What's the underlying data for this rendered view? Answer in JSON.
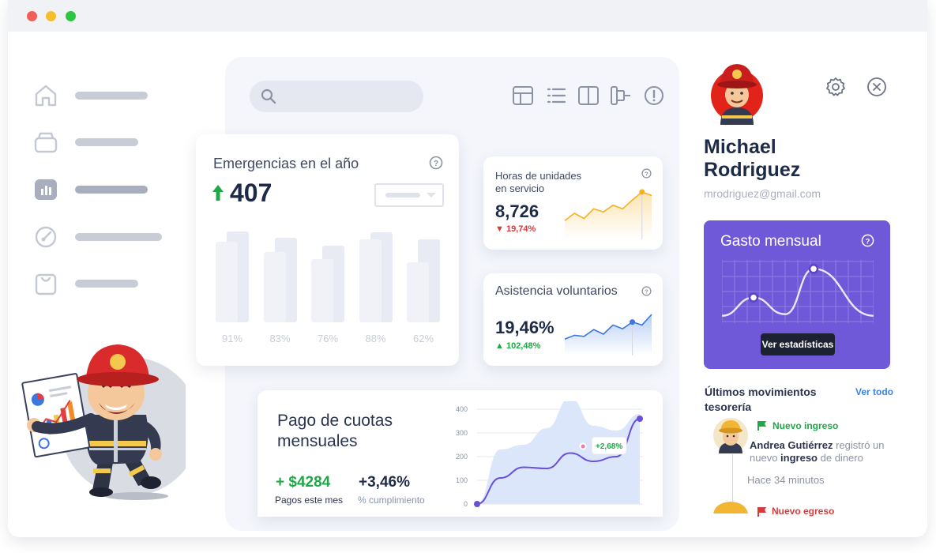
{
  "emergencias": {
    "title": "Emergencias en el año",
    "value": "407",
    "bars": [
      {
        "label": "91%",
        "back": 0.92,
        "front": 0.82
      },
      {
        "label": "83%",
        "back": 0.86,
        "front": 0.71
      },
      {
        "label": "76%",
        "back": 0.78,
        "front": 0.64
      },
      {
        "label": "88%",
        "back": 0.91,
        "front": 0.84
      },
      {
        "label": "62%",
        "back": 0.84,
        "front": 0.61
      }
    ]
  },
  "horas": {
    "title_line1": "Horas de unidades",
    "title_line2": "en servicio",
    "value": "8,726",
    "delta": "19,74%",
    "trend": [
      0.35,
      0.52,
      0.4,
      0.62,
      0.55,
      0.7,
      0.62,
      0.82,
      1.0,
      0.92
    ]
  },
  "asistencia": {
    "title": "Asistencia voluntarios",
    "value": "19,46%",
    "delta": "102,48%",
    "trend": [
      0.35,
      0.45,
      0.42,
      0.6,
      0.48,
      0.72,
      0.62,
      0.8,
      0.72,
      1.0
    ]
  },
  "cuotas": {
    "title_line1": "Pago de cuotas",
    "title_line2": "mensuales",
    "amount": "+ $4284",
    "amount_label": "Pagos este mes",
    "percent": "+3,46%",
    "percent_label": "% cumplimiento",
    "yticks": [
      "400",
      "300",
      "200",
      "100",
      "0"
    ],
    "line": [
      0,
      110,
      155,
      150,
      215,
      180,
      200,
      360
    ],
    "area": [
      0,
      230,
      250,
      320,
      450,
      330,
      310,
      380
    ],
    "tooltip": "+2,68%"
  },
  "user": {
    "first_name": "Michael",
    "last_name": "Rodriguez",
    "email": "mrodriguez@gmail.com"
  },
  "gasto": {
    "title": "Gasto mensual",
    "button": "Ver estadísticas",
    "wave": [
      0.05,
      0.4,
      0.08,
      0.95,
      0.05
    ]
  },
  "movimientos": {
    "title": "Últimos movimientos tesorería",
    "see_all": "Ver todo",
    "items": [
      {
        "tag": "Nuevo ingreso",
        "name": "Andrea Gutiérrez",
        "text1": " registró un nuevo ",
        "keyword": "ingreso",
        "text2": " de dinero",
        "time": "Hace 34 minutos"
      },
      {
        "tag": "Nuevo egreso"
      }
    ]
  },
  "colors": {
    "accent_purple": "#7059d8",
    "up_green": "#1fa845",
    "down_red": "#d83a3a",
    "line_orange": "#f5b120",
    "line_blue": "#3a78e0"
  }
}
